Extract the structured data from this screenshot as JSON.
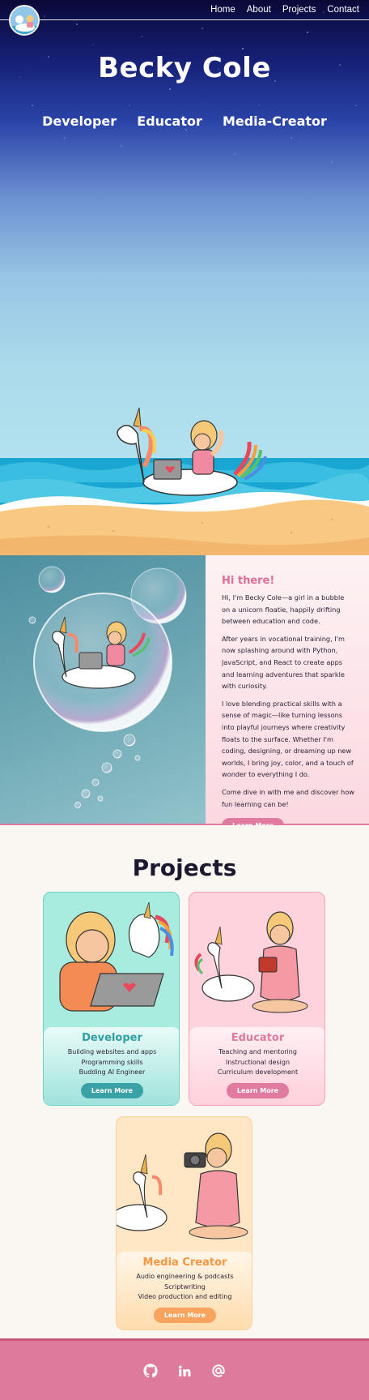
{
  "nav": {
    "links": [
      "Home",
      "About",
      "Projects",
      "Contact"
    ],
    "logo_icon": "unicorn-floatie-logo"
  },
  "hero": {
    "title": "Becky Cole",
    "roles": [
      "Developer",
      "Educator",
      "Media-Creator"
    ]
  },
  "about": {
    "heading": "Hi there!",
    "paragraphs": [
      "Hi, I'm Becky Cole—a girl in a bubble on a unicorn floatie, happily drifting between education and code.",
      "After years in vocational training, I'm now splashing around with Python, JavaScript, and React to create apps and learning adventures that sparkle with curiosity.",
      "I love blending practical skills with a sense of magic—like turning lessons into playful journeys where creativity floats to the surface. Whether I'm coding, designing, or dreaming up new worlds, I bring joy, color, and a touch of wonder to everything I do.",
      "Come dive in with me and discover how fun learning can be!"
    ],
    "button": "Learn More"
  },
  "projects": {
    "title": "Projects",
    "cards": [
      {
        "title": "Developer",
        "items": [
          "Building websites and apps",
          "Programming skills",
          "Budding AI Engineer"
        ],
        "button": "Learn More"
      },
      {
        "title": "Educator",
        "items": [
          "Teaching and mentoring",
          "Instructional design",
          "Curriculum development"
        ],
        "button": "Learn More"
      },
      {
        "title": "Media Creator",
        "items": [
          "Audio engineering & podcasts",
          "Scriptwriting",
          "Video production and editing"
        ],
        "button": "Learn More"
      }
    ]
  },
  "footer": {
    "icons": [
      "github-icon",
      "linkedin-icon",
      "email-at-icon"
    ]
  },
  "colors": {
    "accent_pink": "#e07a9e",
    "accent_teal": "#3aa2a6",
    "accent_orange": "#f8a35e",
    "navy": "#0a0838"
  }
}
